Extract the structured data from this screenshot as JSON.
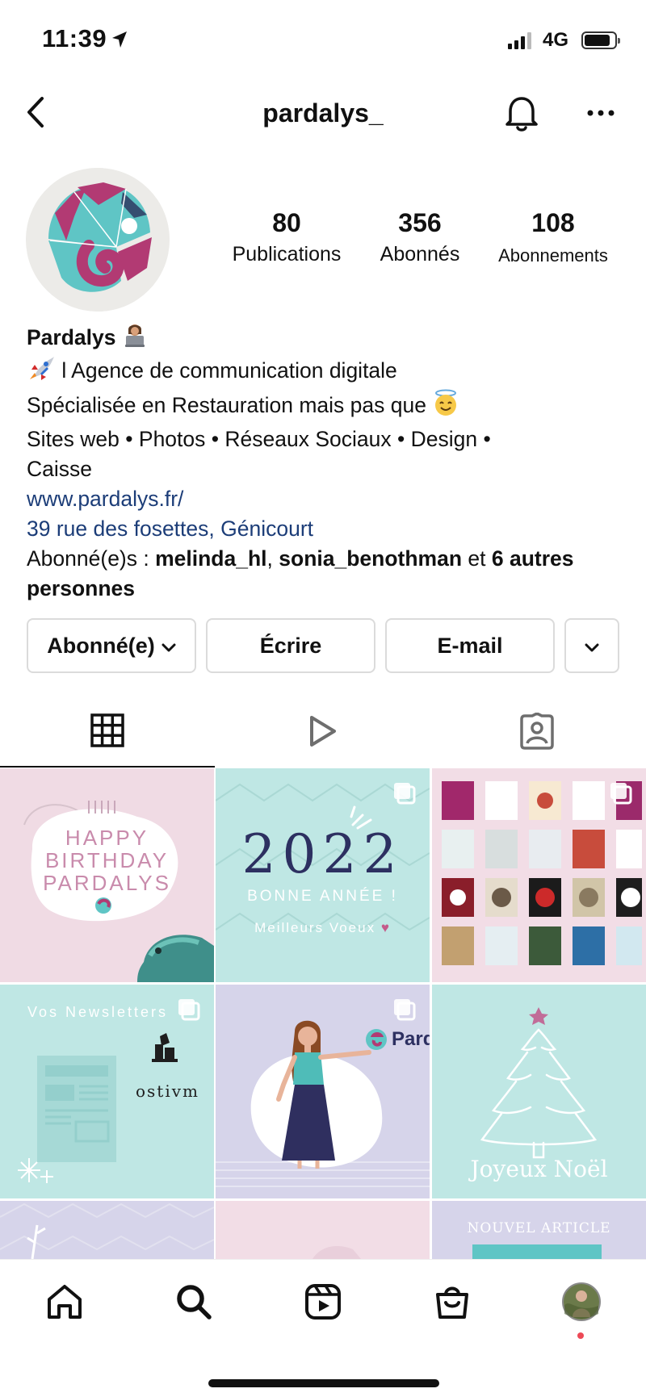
{
  "status": {
    "time": "11:39",
    "network": "4G",
    "icons": [
      "location-arrow-icon",
      "signal-icon",
      "battery-icon"
    ]
  },
  "header": {
    "username": "pardalys_",
    "icons": [
      "back-chevron-icon",
      "bell-icon",
      "more-dots-icon"
    ]
  },
  "profile": {
    "stats": [
      {
        "value": "80",
        "label": "Publications"
      },
      {
        "value": "356",
        "label": "Abonnés"
      },
      {
        "value": "108",
        "label": "Abonnements"
      }
    ]
  },
  "bio": {
    "name": "Pardalys",
    "line1": "l Agence de communication digitale",
    "line2": "Spécialisée en Restauration mais pas que",
    "line3": "Sites web • Photos • Réseaux Sociaux • Design •",
    "line4": "Caisse",
    "website": "www.pardalys.fr/",
    "address": "39 rue des fosettes, Génicourt",
    "followed_prefix": "Abonné(e)s : ",
    "followed_user1": "melinda_hl",
    "followed_sep": ", ",
    "followed_user2": "sonia_benothman",
    "followed_and": " et ",
    "followed_others": "6 autres personnes"
  },
  "actions": {
    "follow": "Abonné(e)",
    "message": "Écrire",
    "email": "E-mail"
  },
  "tabs": [
    "grid-icon",
    "reels-icon",
    "tagged-icon"
  ],
  "posts": {
    "birthday": {
      "line1": "HAPPY",
      "line2": "BIRTHDAY",
      "line3": "PARDALYS"
    },
    "newyear": {
      "year": "2022",
      "line1": "BONNE ANNÉE !",
      "line2": "Meilleurs Voeux"
    },
    "newsletter": {
      "title": "Vos Newsletters",
      "brand": "ostivm"
    },
    "brand_partial": "Pard",
    "christmas": {
      "text": "Joyeux Noël"
    },
    "article": {
      "text": "NOUVEL ARTICLE"
    }
  },
  "bottom_nav": [
    "home-icon",
    "search-icon",
    "reels-icon",
    "shop-icon",
    "profile-avatar"
  ],
  "colors": {
    "teal": "#5fc5c5",
    "magenta": "#b23a73",
    "pink_bg": "#f0dbe4",
    "mint_bg": "#bfe7e4",
    "lavender_bg": "#d6d4ea",
    "link": "#1c3d78"
  }
}
